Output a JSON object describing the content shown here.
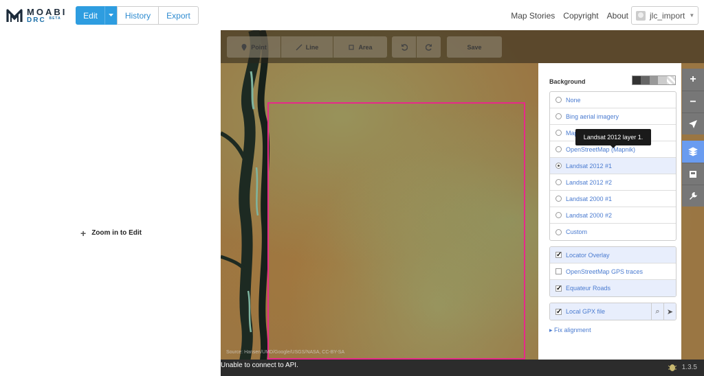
{
  "header": {
    "logo": {
      "line1": "MOABI",
      "line2": "DRC",
      "badge": "BETA"
    },
    "modes": {
      "edit": "Edit",
      "history": "History",
      "export": "Export"
    },
    "links": [
      "Map Stories",
      "Copyright",
      "About"
    ],
    "user": "jlc_import"
  },
  "sidebar": {
    "zoom_label": "Zoom in to Edit"
  },
  "toolbar": {
    "point": "Point",
    "line": "Line",
    "area": "Area",
    "save": "Save"
  },
  "background_pane": {
    "title": "Background",
    "options": [
      {
        "label": "None",
        "selected": false
      },
      {
        "label": "Bing aerial imagery",
        "selected": false
      },
      {
        "label": "MapBox Satellite",
        "selected": false
      },
      {
        "label": "OpenStreetMap (Mapnik)",
        "selected": false
      },
      {
        "label": "Landsat 2012 #1",
        "selected": true
      },
      {
        "label": "Landsat 2012 #2",
        "selected": false
      },
      {
        "label": "Landsat 2000 #1",
        "selected": false
      },
      {
        "label": "Landsat 2000 #2",
        "selected": false
      },
      {
        "label": "Custom",
        "selected": false
      }
    ],
    "overlays": [
      {
        "label": "Locator Overlay",
        "checked": true
      },
      {
        "label": "OpenStreetMap GPS traces",
        "checked": false
      },
      {
        "label": "Equateur Roads",
        "checked": true
      }
    ],
    "gpx": {
      "label": "Local GPX file",
      "checked": true
    },
    "fix_alignment": "Fix alignment",
    "tooltip": "Landsat 2012 layer 1."
  },
  "map": {
    "attribution": "Source: Hansen/UMD/Google/USGS/NASA, CC-BY-SA",
    "status": "Unable to connect to API.",
    "version": "1.3.5"
  },
  "colors": {
    "accent": "#2e9de0",
    "selection_box": "#e8288a",
    "link": "#4a7bd0",
    "control_active": "#6a9cf0"
  }
}
